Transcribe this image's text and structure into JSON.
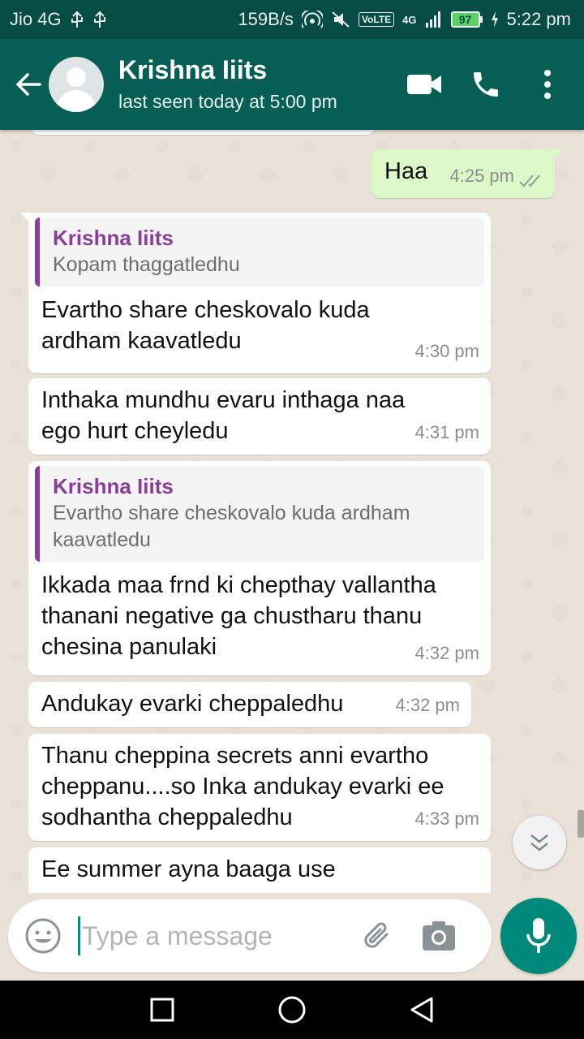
{
  "status_bar": {
    "carrier": "Jio 4G",
    "speed": "159B/s",
    "volte": "VoLTE",
    "network": "4G",
    "battery": "97",
    "time": "5:22 pm"
  },
  "header": {
    "contact_name": "Krishna Iiits",
    "last_seen": "last seen today at 5:00 pm",
    "icons": [
      "back-arrow-icon",
      "avatar",
      "video-call-icon",
      "phone-icon",
      "more-vert-icon"
    ]
  },
  "messages": [
    {
      "direction": "out",
      "text": "Haa",
      "time": "4:25 pm",
      "status": "read"
    },
    {
      "direction": "in",
      "quote_name": "Krishna Iiits",
      "quote_text": "Kopam thaggatledhu",
      "text": "Evartho share cheskovalo kuda ardham kaavatledu",
      "time": "4:30 pm"
    },
    {
      "direction": "in",
      "text": "Inthaka mundhu evaru inthaga naa ego hurt cheyledu",
      "time": "4:31 pm"
    },
    {
      "direction": "in",
      "quote_name": "Krishna Iiits",
      "quote_text": "Evartho share cheskovalo kuda ardham kaavatledu",
      "text": "Ikkada maa frnd ki chepthay vallantha thanani negative ga chustharu thanu chesina panulaki",
      "time": "4:32 pm"
    },
    {
      "direction": "in",
      "text": "Andukay evarki cheppaledhu",
      "time": "4:32 pm"
    },
    {
      "direction": "in",
      "text": "Thanu cheppina secrets anni evartho cheppanu....so Inka andukay evarki ee sodhantha cheppaledhu",
      "time": "4:33 pm"
    },
    {
      "direction": "in",
      "text": "Ee summer ayna baaga use",
      "time": ""
    }
  ],
  "composer": {
    "placeholder": "Type a message",
    "value": ""
  },
  "colors": {
    "header": "#075e54",
    "status_bar": "#054d44",
    "outgoing_bubble": "#dcf8c6",
    "quote_accent": "#8a3d99",
    "mic_button": "#00897b"
  }
}
